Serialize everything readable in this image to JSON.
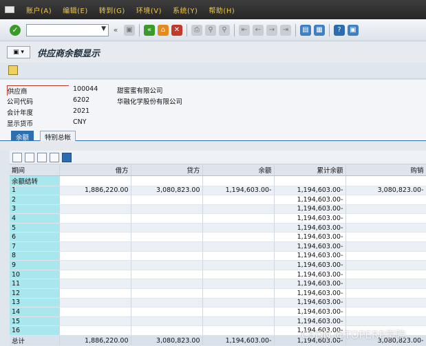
{
  "menu": [
    "账户(A)",
    "编辑(E)",
    "转到(G)",
    "环境(V)",
    "系统(Y)",
    "帮助(H)"
  ],
  "toolbar": {
    "command_value": ""
  },
  "title": "供应商余额显示",
  "header": {
    "fields": [
      {
        "label": "供应商",
        "value": "100044",
        "text": "甜蜜蜜有限公司"
      },
      {
        "label": "公司代码",
        "value": "6202",
        "text": "华融化学股份有限公司"
      },
      {
        "label": "会计年度",
        "value": "2021",
        "text": ""
      },
      {
        "label": "显示货币",
        "value": "CNY",
        "text": ""
      }
    ]
  },
  "tabs": [
    "余额",
    "特别总帐"
  ],
  "table": {
    "columns": [
      "期间",
      "借方",
      "贷方",
      "余额",
      "累计余额",
      "购销"
    ],
    "rows": [
      [
        "余额结转",
        "",
        "",
        "",
        "",
        ""
      ],
      [
        "1",
        "1,886,220.00",
        "3,080,823.00",
        "1,194,603.00-",
        "1,194,603.00-",
        "3,080,823.00-"
      ],
      [
        "2",
        "",
        "",
        "",
        "1,194,603.00-",
        ""
      ],
      [
        "3",
        "",
        "",
        "",
        "1,194,603.00-",
        ""
      ],
      [
        "4",
        "",
        "",
        "",
        "1,194,603.00-",
        ""
      ],
      [
        "5",
        "",
        "",
        "",
        "1,194,603.00-",
        ""
      ],
      [
        "6",
        "",
        "",
        "",
        "1,194,603.00-",
        ""
      ],
      [
        "7",
        "",
        "",
        "",
        "1,194,603.00-",
        ""
      ],
      [
        "8",
        "",
        "",
        "",
        "1,194,603.00-",
        ""
      ],
      [
        "9",
        "",
        "",
        "",
        "1,194,603.00-",
        ""
      ],
      [
        "10",
        "",
        "",
        "",
        "1,194,603.00-",
        ""
      ],
      [
        "11",
        "",
        "",
        "",
        "1,194,603.00-",
        ""
      ],
      [
        "12",
        "",
        "",
        "",
        "1,194,603.00-",
        ""
      ],
      [
        "13",
        "",
        "",
        "",
        "1,194,603.00-",
        ""
      ],
      [
        "14",
        "",
        "",
        "",
        "1,194,603.00-",
        ""
      ],
      [
        "15",
        "",
        "",
        "",
        "1,194,603.00-",
        ""
      ],
      [
        "16",
        "",
        "",
        "",
        "1,194,603.00-",
        ""
      ],
      [
        "总计",
        "1,886,220.00",
        "3,080,823.00",
        "1,194,603.00-",
        "1,194,603.00-",
        "3,080,823.00-"
      ]
    ]
  },
  "watermark": "CSDN @TOPERP学院"
}
